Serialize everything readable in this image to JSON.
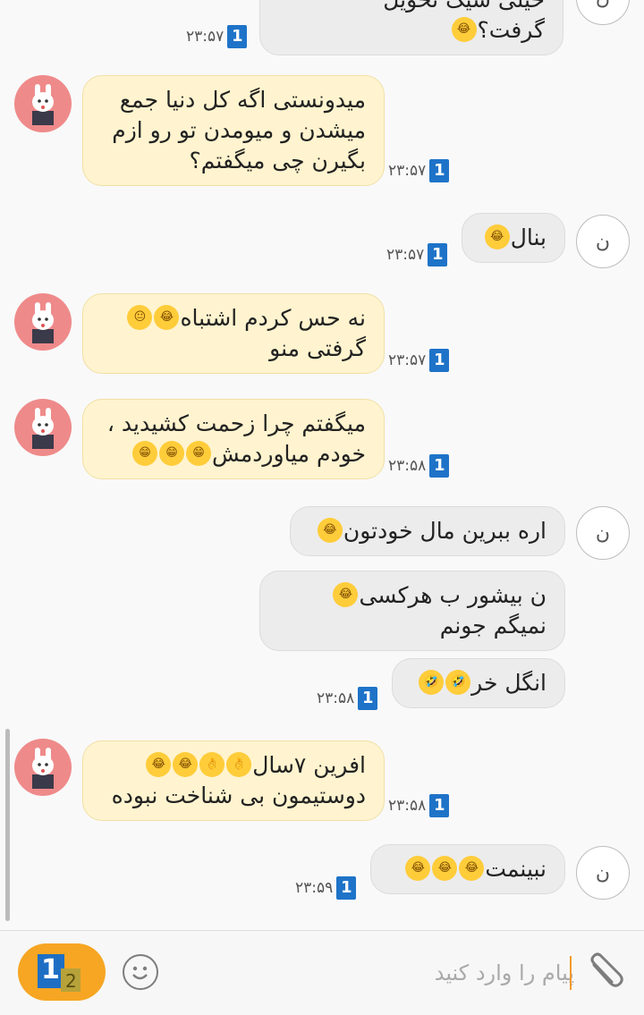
{
  "colors": {
    "incoming_bubble": "#fff4cf",
    "outgoing_bubble": "#ececec",
    "avatar_other": "#ef8a8a",
    "seen_badge": "#1e73c8",
    "sticker_button": "#f6a623"
  },
  "contact_initial": "ن",
  "seen_badge_text": "1",
  "messages": [
    {
      "side": "me",
      "lines": [
        "خیلی شیک تحویل",
        "گرفت؟"
      ],
      "emoji_end": [
        "laughing-tears"
      ],
      "time": "۲۳:۵۷"
    },
    {
      "side": "other",
      "lines": [
        "میدونستی اگه کل دنیا جمع",
        "میشدن و میومدن تو رو ازم",
        "بگیرن چی میگفتم؟"
      ],
      "time": "۲۳:۵۷"
    },
    {
      "side": "me",
      "lines": [
        "بنال"
      ],
      "emoji": [
        "laughing-tears"
      ],
      "time": "۲۳:۵۷"
    },
    {
      "side": "other",
      "lines": [
        "نه حس کردم اشتباه",
        "گرفتی منو"
      ],
      "emoji": [
        "laughing-tears",
        "neutral-face"
      ],
      "time": "۲۳:۵۷"
    },
    {
      "side": "other",
      "lines": [
        "میگفتم چرا زحمت کشیدید ،",
        "خودم میاوردمش"
      ],
      "emoji": [
        "grinning",
        "grinning",
        "grinning"
      ],
      "time": "۲۳:۵۸"
    },
    {
      "side": "me",
      "lines": [
        "اره ببرین مال خودتون"
      ],
      "emoji": [
        "laughing-tears"
      ]
    },
    {
      "side": "me",
      "lines": [
        "ن بیشور ب هرکسی",
        "نمیگم جونم"
      ],
      "emoji": [
        "laughing-tears"
      ]
    },
    {
      "side": "me",
      "lines": [
        "انگل خر"
      ],
      "emoji": [
        "rofl",
        "rofl"
      ],
      "time": "۲۳:۵۸"
    },
    {
      "side": "other",
      "lines": [
        "افرین ۷سال",
        "دوستیمون بی شناخت نبوده"
      ],
      "emoji": [
        "ok-hand",
        "ok-hand",
        "laughing-tears",
        "laughing-tears"
      ],
      "time": "۲۳:۵۸"
    },
    {
      "side": "me",
      "lines": [
        "نبینمت"
      ],
      "emoji": [
        "laughing-tears",
        "laughing-tears",
        "laughing-tears"
      ],
      "time": "۲۳:۵۹"
    }
  ],
  "input": {
    "placeholder": "پیام را وارد کنید",
    "sticker_badge": "1",
    "sticker_badge_small": "2"
  }
}
